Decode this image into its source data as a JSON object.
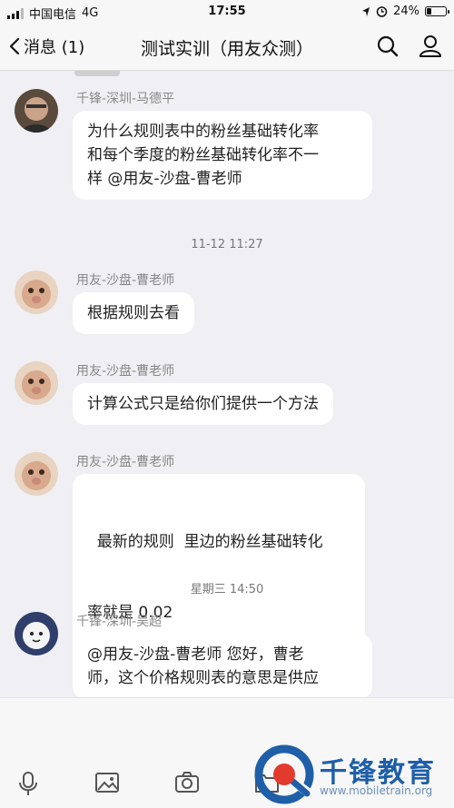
{
  "status_bar": {
    "carrier": "中国电信",
    "network": "4G",
    "time": "17:55",
    "battery": "24%",
    "battery_level": 0.24
  },
  "nav": {
    "back_label": "消息 (1)",
    "title": "测试实训（用友众测）"
  },
  "messages": [
    {
      "sender": "千锋-深圳-马德平",
      "text_lines": [
        "为什么规则表中的粉丝基础转化率",
        "和每个季度的粉丝基础转化率不一",
        "样 @用友-沙盘-曹老师"
      ]
    },
    {
      "timestamp": "11-12 11:27"
    },
    {
      "sender": "用友-沙盘-曹老师",
      "text_lines": [
        "根据规则去看"
      ]
    },
    {
      "sender": "用友-沙盘-曹老师",
      "text_lines": [
        "计算公式只是给你们提供一个方法"
      ]
    },
    {
      "sender": "用友-沙盘-曹老师",
      "text_lines": [
        "  最新的规则  里边的粉丝基础转化",
        "率就是 0.02"
      ]
    },
    {
      "timestamp": "星期三 14:50"
    },
    {
      "sender": "千锋-深圳-吴超",
      "text_lines": [
        "@用友-沙盘-曹老师 您好，曹老",
        "师，这个价格规则表的意思是供应"
      ]
    }
  ],
  "toolbar": {
    "icons": [
      "microphone-icon",
      "image-icon",
      "camera-icon",
      "folder-icon"
    ]
  },
  "watermark": {
    "name": "千锋教育",
    "url": "www.mobiletrain.org"
  },
  "colors": {
    "background": "#efeff4",
    "bubble": "#ffffff",
    "brand": "#1e5fa8"
  }
}
